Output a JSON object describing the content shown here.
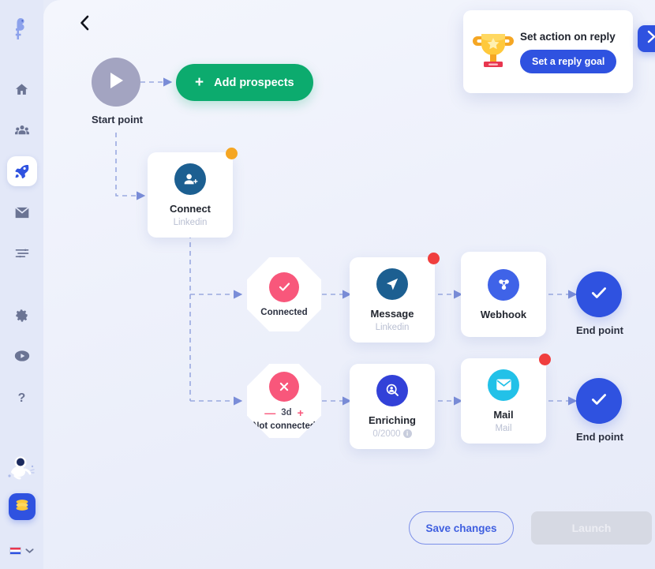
{
  "sidebar": {
    "logo": {
      "name": "flamingo-logo"
    },
    "items": [
      {
        "name": "home-icon",
        "label": "Home",
        "active": false
      },
      {
        "name": "team-icon",
        "label": "Team",
        "active": false
      },
      {
        "name": "rocket-icon",
        "label": "Campaigns",
        "active": true
      },
      {
        "name": "mail-icon",
        "label": "Inbox",
        "active": false
      },
      {
        "name": "filters-icon",
        "label": "Filters",
        "active": false
      },
      {
        "name": "gear-icon",
        "label": "Settings",
        "active": false
      },
      {
        "name": "play-circle-icon",
        "label": "Tutorials",
        "active": false
      },
      {
        "name": "help-icon",
        "label": "Help",
        "active": false
      }
    ],
    "astronaut": "astronaut-illustration",
    "coins_button": "coins-icon",
    "language": {
      "flag": "flag-icon",
      "chevron": "chevron-down-icon"
    }
  },
  "header": {
    "back_button": "chevron-left-icon"
  },
  "toast": {
    "icon": "trophy-icon",
    "title": "Set action on reply",
    "cta_label": "Set a reply goal",
    "next_button": "chevron-right-icon"
  },
  "flow": {
    "start": {
      "label": "Start point",
      "icon": "play-icon"
    },
    "add_prospects": {
      "label": "Add prospects",
      "plus": "+"
    },
    "connect": {
      "title": "Connect",
      "subtitle": "Linkedin",
      "icon": "add-user-icon",
      "badge": "orange"
    },
    "connected": {
      "label": "Connected",
      "icon": "check-icon"
    },
    "not_connected": {
      "label": "Not connected",
      "icon": "close-icon",
      "delay": "3d",
      "minus": "—",
      "plus": "+"
    },
    "message": {
      "title": "Message",
      "subtitle": "Linkedin",
      "icon": "send-icon",
      "badge": "red"
    },
    "webhook": {
      "title": "Webhook",
      "subtitle": "",
      "icon": "webhook-icon"
    },
    "enriching": {
      "title": "Enriching",
      "count": "0/2000",
      "icon": "search-person-icon",
      "info": "i"
    },
    "mail": {
      "title": "Mail",
      "subtitle": "Mail",
      "icon": "envelope-icon",
      "badge": "red"
    },
    "end_point_top": {
      "label": "End point",
      "icon": "check-icon"
    },
    "end_point_bottom": {
      "label": "End point",
      "icon": "check-icon"
    }
  },
  "footer": {
    "save_label": "Save changes",
    "launch_label": "Launch"
  },
  "colors": {
    "accent_blue": "#2f52e0",
    "green": "#0cab6e",
    "pink": "#f8577b",
    "orange": "#f5a623",
    "red": "#f03e3e",
    "cyan": "#22c1e8",
    "linkedin_blue": "#1c5f91",
    "sidebar_bg": "#e3e8f8"
  }
}
